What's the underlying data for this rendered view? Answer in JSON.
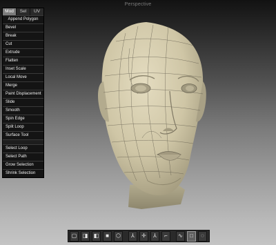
{
  "viewport": {
    "title": "Perspective"
  },
  "tabs": [
    {
      "label": "Mod",
      "active": true
    },
    {
      "label": "Sel",
      "active": false
    },
    {
      "label": "UV",
      "active": false
    }
  ],
  "tools": [
    "Append Polygon",
    "Bevel",
    "Break",
    "Cut",
    "Extrude",
    "Flatten",
    "Inset Scale",
    "Local Move",
    "Merge",
    "Paint Displacement",
    "Slide",
    "Smooth",
    "Spin Edge",
    "Split Loop",
    "Surface Tool"
  ],
  "selection_tools": [
    "Select Loop",
    "Select Path",
    "Grow Selection",
    "Shrink Selection"
  ],
  "toolbar": {
    "icons": [
      "cube-wire-icon",
      "cube-solid-icon",
      "cube-light-icon",
      "cube-shaded-icon",
      "hexagon-icon",
      "axis-y-icon",
      "axis-x-icon",
      "axis-z-icon",
      "axis-corner-icon",
      "curve-icon",
      "select-box-icon",
      "lasso-icon"
    ],
    "glyphs": [
      "▢",
      "◨",
      "◧",
      "■",
      "⬡",
      "⅄",
      "✛",
      "⅄",
      "⌐",
      "∿",
      "□",
      "◌"
    ],
    "active_index": 10
  },
  "colors": {
    "mesh": "#cfc7a9",
    "wire": "#555046",
    "panel": "#141414"
  }
}
